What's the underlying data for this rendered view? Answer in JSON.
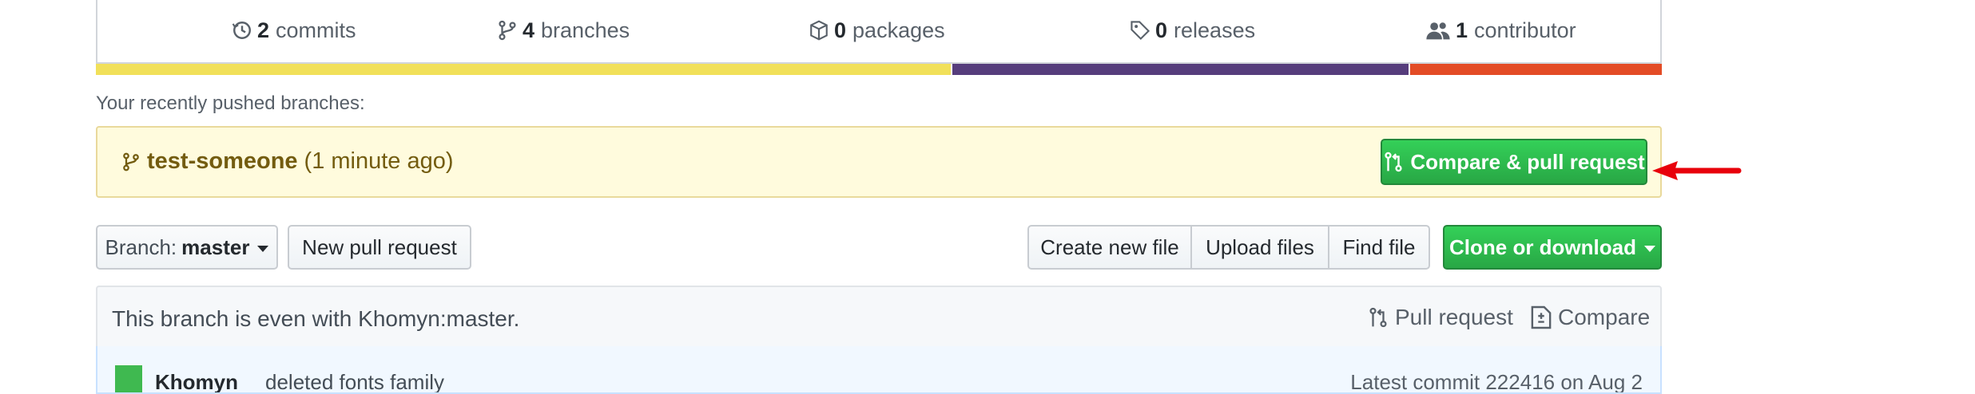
{
  "summary": {
    "commits": {
      "count": "2",
      "label": "commits"
    },
    "branches": {
      "count": "4",
      "label": "branches"
    },
    "packages": {
      "count": "0",
      "label": "packages"
    },
    "releases": {
      "count": "0",
      "label": "releases"
    },
    "contributors": {
      "count": "1",
      "label": "contributor"
    }
  },
  "language_bar": [
    {
      "color": "#f1e05a",
      "percent": 54.7
    },
    {
      "color": "#563d7c",
      "percent": 29.2
    },
    {
      "color": "#e34c26",
      "percent": 16.1
    }
  ],
  "recent": {
    "label": "Your recently pushed branches:",
    "branch": "test-someone",
    "time": "(1 minute ago)",
    "compare_button": "Compare & pull request"
  },
  "toolbar": {
    "branch_prefix": "Branch:",
    "branch_name": "master",
    "new_pr": "New pull request",
    "create_file": "Create new file",
    "upload_files": "Upload files",
    "find_file": "Find file",
    "clone": "Clone or download"
  },
  "branch_info": {
    "message": "This branch is even with Khomyn:master.",
    "pull_request": "Pull request",
    "compare": "Compare"
  },
  "commit": {
    "author": "Khomyn",
    "message": "deleted fonts family",
    "latest": "Latest commit 222416 on Aug 2"
  },
  "colors": {
    "accent_green": "#28a745",
    "annotation_arrow": "#e8000b"
  },
  "icons": [
    "history-icon",
    "branch-icon",
    "package-icon",
    "tag-icon",
    "people-icon",
    "git-compare-icon",
    "file-diff-icon",
    "red-arrow-annotation"
  ]
}
